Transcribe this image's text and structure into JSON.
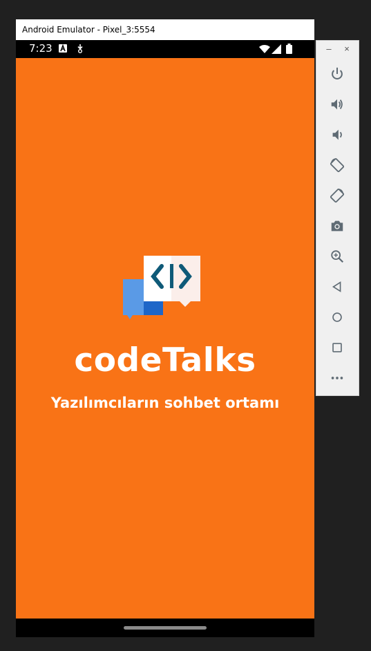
{
  "window": {
    "title": "Android Emulator - Pixel_3:5554"
  },
  "status_bar": {
    "time": "7:23"
  },
  "app": {
    "name": "codeTalks",
    "tagline": "Yazılımcıların sohbet ortamı"
  },
  "colors": {
    "splash_background": "#f97316",
    "logo_blue": "#5a9ae6",
    "logo_dark_blue": "#1e66c8",
    "logo_code": "#0f5a78"
  },
  "side_toolbar": {
    "window_controls": [
      "minimize-icon",
      "close-icon"
    ],
    "buttons": [
      "power-icon",
      "volume-up-icon",
      "volume-down-icon",
      "rotate-left-icon",
      "rotate-right-icon",
      "camera-icon",
      "zoom-icon",
      "back-icon",
      "home-icon",
      "overview-icon",
      "more-icon"
    ]
  }
}
